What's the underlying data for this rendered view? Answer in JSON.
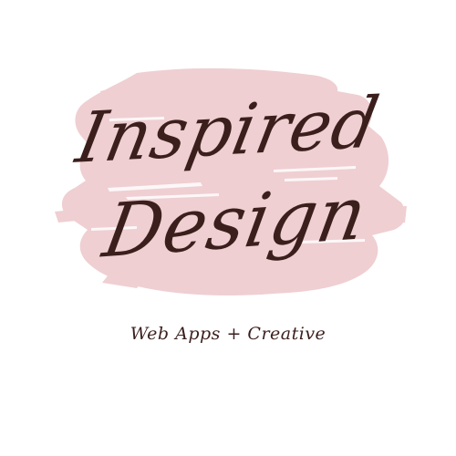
{
  "logo": {
    "line1": "Inspired",
    "line2": "Design",
    "tagline": "Web Apps + Creative"
  },
  "colors": {
    "background": "#ffffff",
    "brush": "#efcfd2",
    "text": "#3b1f1d"
  }
}
